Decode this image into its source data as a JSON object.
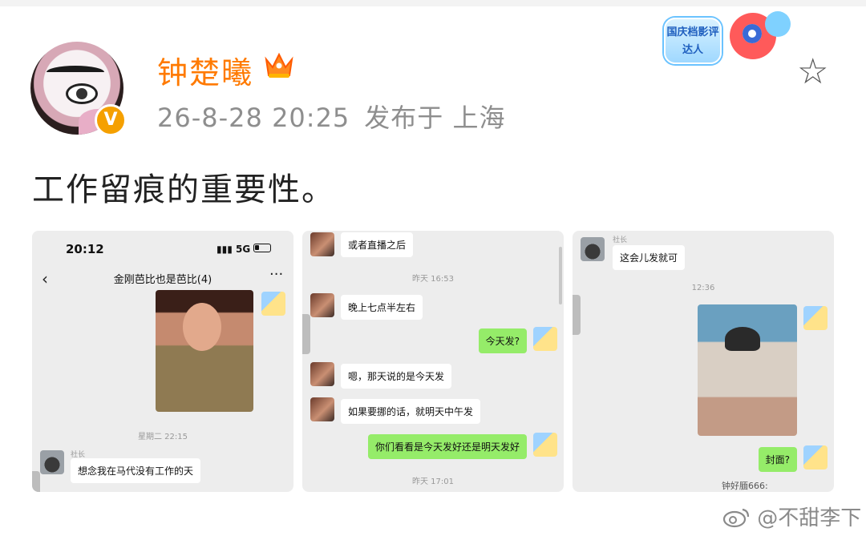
{
  "post": {
    "username": "钟楚曦",
    "timestamp": "26-8-28 20:25",
    "location": "发布于 上海",
    "text": "工作留痕的重要性。",
    "event_badge": "国庆档影评达人",
    "verified_badge": "V"
  },
  "watermark": "@不甜李下",
  "screenshot1": {
    "time": "20:12",
    "network": "5G",
    "chat_title": "金刚芭比也是芭比(4)",
    "timestamp": "星期二 22:15",
    "sender_label": "社长",
    "message": "想念我在马代没有工作的天"
  },
  "screenshot2": {
    "msg1": "或者直播之后",
    "ts1": "昨天 16:53",
    "msg2": "晚上七点半左右",
    "msg3": "今天发?",
    "msg4": "嗯，那天说的是今天发",
    "msg5": "如果要挪的话，就明天中午发",
    "msg6": "你们看看是今天发好还是明天发好",
    "ts2": "昨天 17:01"
  },
  "screenshot3": {
    "sender_label": "社长",
    "msg1": "这会儿发就可",
    "ts1": "12:36",
    "msg2": "封面?",
    "partial": "钟好腼666:"
  }
}
